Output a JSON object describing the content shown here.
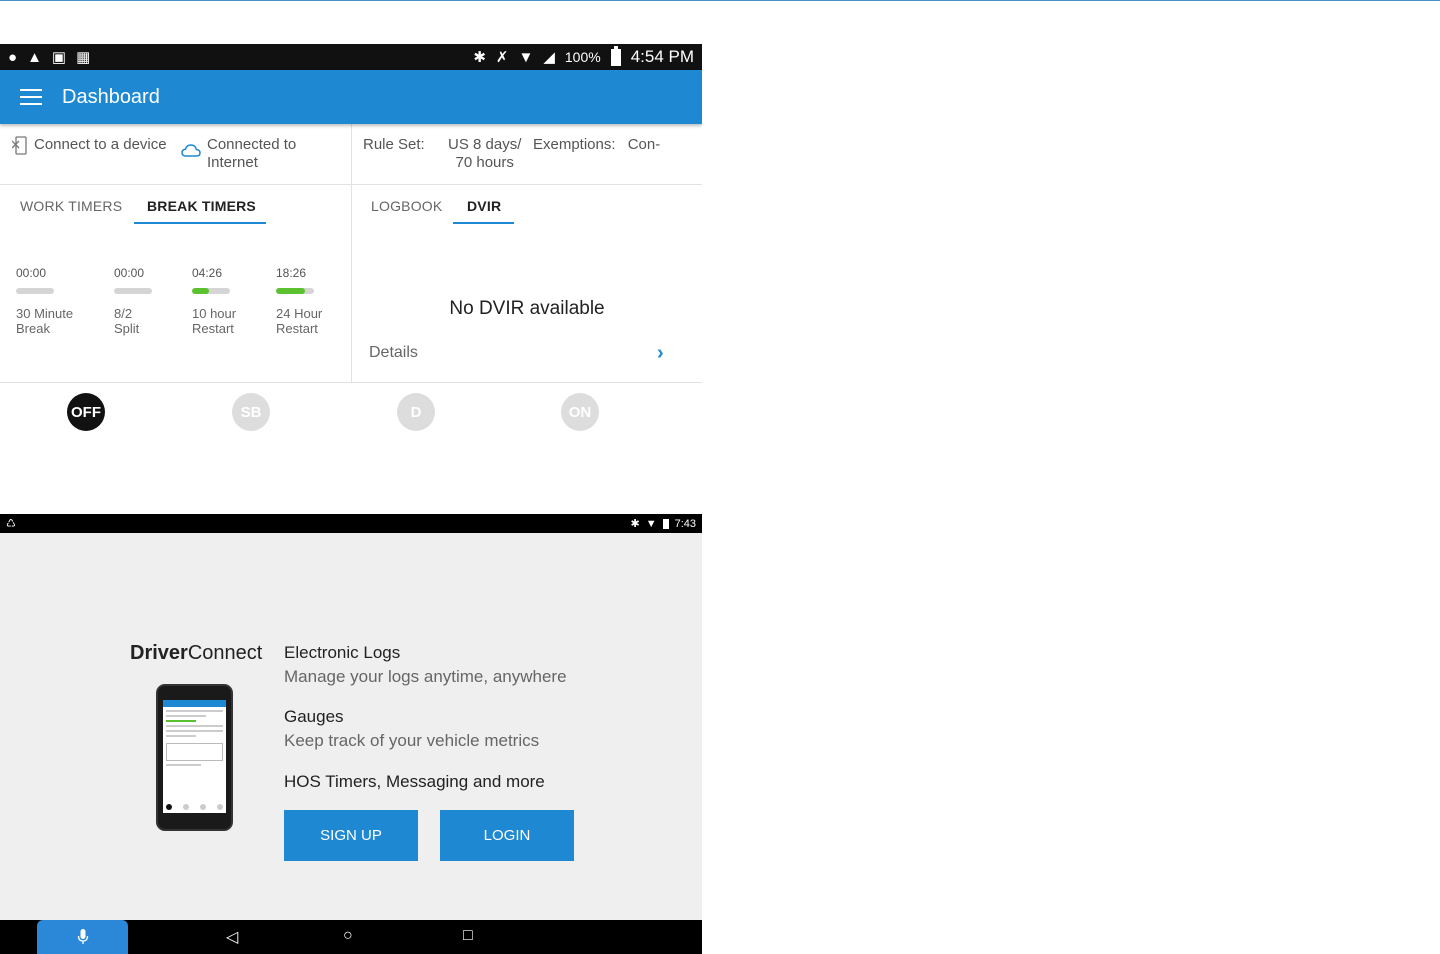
{
  "dashboard": {
    "status_bar": {
      "battery_pct": "100%",
      "time": "4:54 PM",
      "left_icons": [
        "alert-circle-icon",
        "warning-icon",
        "image-icon",
        "clipboard-icon"
      ],
      "right_icons": [
        "bluetooth-icon",
        "mute-icon",
        "wifi-icon",
        "signal-icon",
        "battery-icon"
      ]
    },
    "appbar": {
      "title": "Dashboard"
    },
    "connection": {
      "device_label": "Connect to a device",
      "internet_label_1": "Connected to",
      "internet_label_2": "Internet"
    },
    "ruleset": {
      "label": "Rule Set:",
      "value_1": "US 8 days/",
      "value_2": "70 hours"
    },
    "exemptions": {
      "label": "Exemptions:",
      "value": "Con-"
    },
    "tabs_left": [
      {
        "label": "WORK TIMERS",
        "active": false
      },
      {
        "label": "BREAK TIMERS",
        "active": true
      }
    ],
    "tabs_right": [
      {
        "label": "LOGBOOK",
        "active": false
      },
      {
        "label": "DVIR",
        "active": true
      }
    ],
    "timers": [
      {
        "time": "00:00",
        "label_1": "30 Minute",
        "label_2": "Break",
        "progress": 0
      },
      {
        "time": "00:00",
        "label_1": "8/2",
        "label_2": "Split",
        "progress": 0
      },
      {
        "time": "04:26",
        "label_1": "10 hour",
        "label_2": "Restart",
        "progress": 0.45
      },
      {
        "time": "18:26",
        "label_1": "24 Hour",
        "label_2": "Restart",
        "progress": 0.77
      }
    ],
    "dvir": {
      "empty_text": "No DVIR available",
      "details_label": "Details"
    },
    "duty_status": [
      {
        "label": "OFF",
        "active": true
      },
      {
        "label": "SB",
        "active": false
      },
      {
        "label": "D",
        "active": false
      },
      {
        "label": "ON",
        "active": false
      }
    ],
    "colors": {
      "accent": "#1e88d2",
      "progress": "#5cc12f"
    }
  },
  "login": {
    "status_bar": {
      "time": "7:43"
    },
    "brand": {
      "bold": "Driver",
      "regular": "Connect"
    },
    "features": [
      {
        "title": "Electronic Logs",
        "desc": "Manage your logs anytime, anywhere"
      },
      {
        "title": "Gauges",
        "desc": "Keep track of your vehicle metrics"
      },
      {
        "title": "HOS Timers, Messaging and more",
        "desc": ""
      }
    ],
    "buttons": {
      "signup": "SIGN UP",
      "login": "LOGIN"
    },
    "nav_icons": [
      "mic-icon",
      "back-icon",
      "home-icon",
      "recents-icon"
    ]
  }
}
